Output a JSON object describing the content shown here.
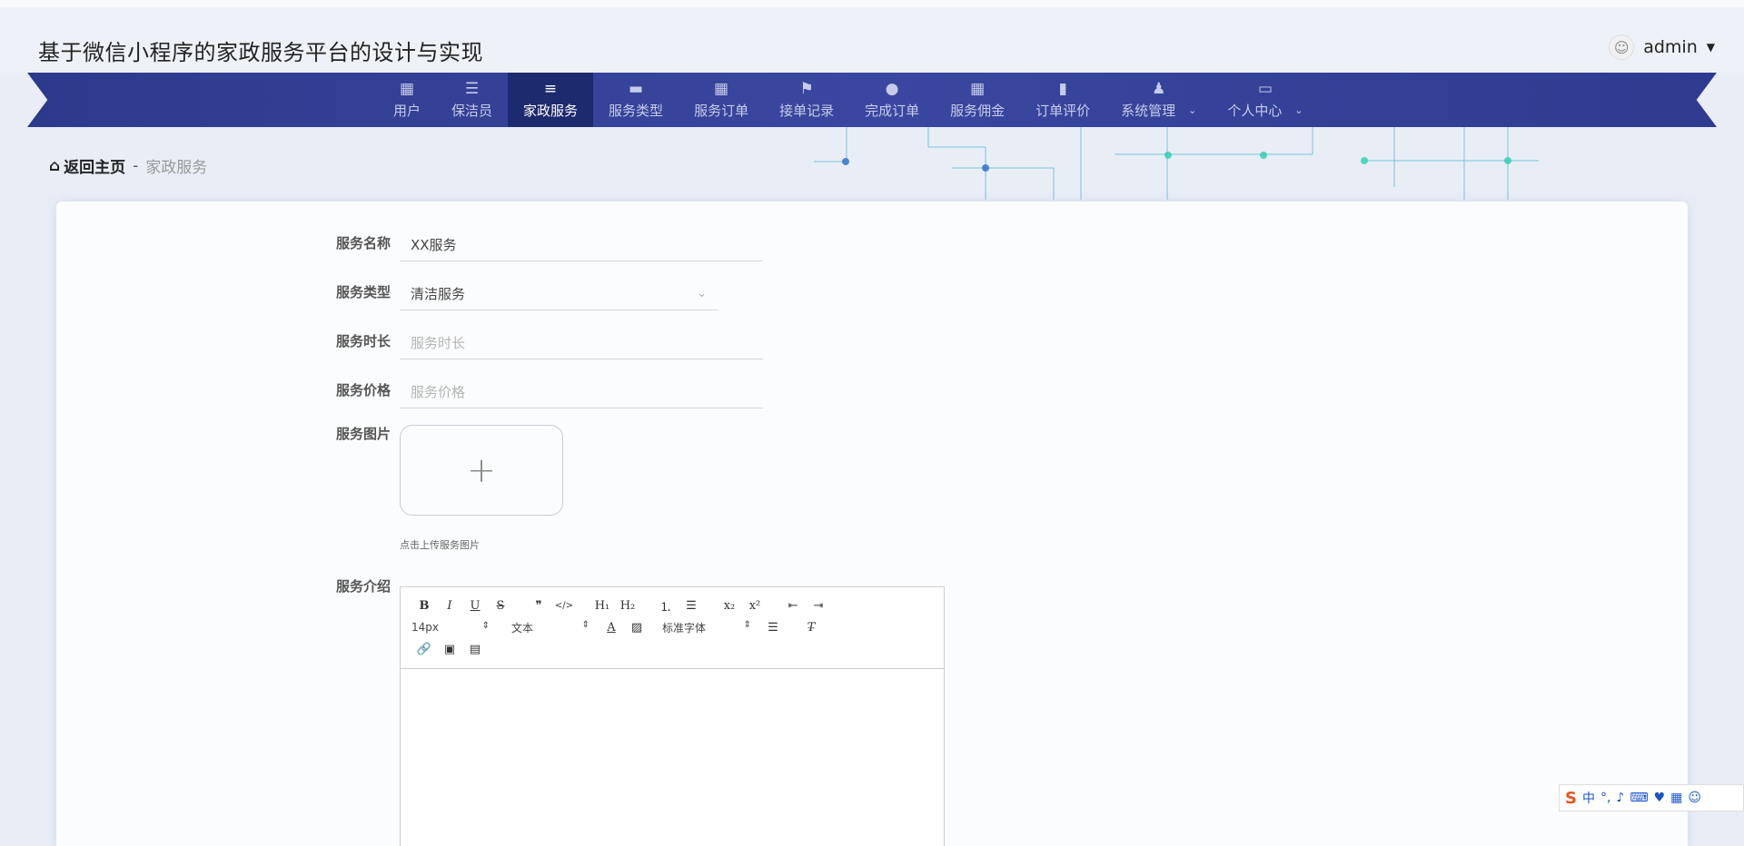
{
  "header": {
    "site_title": "基于微信小程序的家政服务平台的设计与实现",
    "user_name": "admin"
  },
  "nav": {
    "items": [
      {
        "label": "用户",
        "icon": "dashboard-grid-icon"
      },
      {
        "label": "保洁员",
        "icon": "list-icon"
      },
      {
        "label": "家政服务",
        "icon": "menu-lines-icon",
        "active": true
      },
      {
        "label": "服务类型",
        "icon": "monitor-icon"
      },
      {
        "label": "服务订单",
        "icon": "dashboard-grid-icon"
      },
      {
        "label": "接单记录",
        "icon": "flag-icon"
      },
      {
        "label": "完成订单",
        "icon": "bulb-icon"
      },
      {
        "label": "服务佣金",
        "icon": "dashboard-grid-icon"
      },
      {
        "label": "订单评价",
        "icon": "book-icon"
      },
      {
        "label": "系统管理",
        "icon": "user-stamp-icon",
        "dropdown": true
      },
      {
        "label": "个人中心",
        "icon": "wallet-icon",
        "dropdown": true
      }
    ]
  },
  "breadcrumb": {
    "home": "返回主页",
    "separator": "-",
    "current": "家政服务"
  },
  "form": {
    "name_label": "服务名称",
    "name_value": "XX服务",
    "type_label": "服务类型",
    "type_value": "清洁服务",
    "duration_label": "服务时长",
    "duration_placeholder": "服务时长",
    "price_label": "服务价格",
    "price_placeholder": "服务价格",
    "image_label": "服务图片",
    "image_hint": "点击上传服务图片",
    "intro_label": "服务介绍"
  },
  "editor": {
    "font_size": "14px",
    "header_select": "文本",
    "font_family": "标准字体"
  },
  "colors": {
    "nav_bg": "#3a47a0",
    "nav_active": "#1e2a6e",
    "background": "#e9eef6"
  }
}
